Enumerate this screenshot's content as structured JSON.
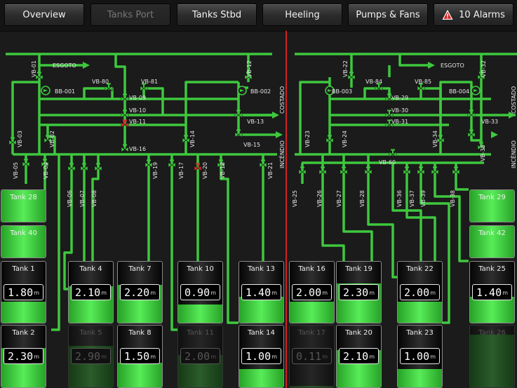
{
  "nav": {
    "overview": "Overview",
    "tanks_port": "Tanks Port",
    "tanks_stbd": "Tanks Stbd",
    "heeling": "Heeling",
    "pumps_fans": "Pumps & Fans",
    "alarms": "10 Alarms"
  },
  "colors": {
    "pipe": "#3ec83e",
    "valve_alarm": "#e0282e",
    "divider": "#d42020"
  },
  "valves": {
    "vb01": "VB-01",
    "vb02": "VB-02",
    "vb03": "VB-03",
    "vb04": "VB-04",
    "vb05": "VB-05",
    "vb06": "VB-06",
    "vb07": "VB-07",
    "vb08": "VB-08",
    "vb09": "VB-09",
    "vb10": "VB-10",
    "vb11": "VB-11",
    "vb12": "VB-12",
    "vb13": "VB-13",
    "vb14": "VB-14",
    "vb15": "VB-15",
    "vb16": "VB-16",
    "vb17": "VB-17",
    "vb18": "VB-18",
    "vb19": "VB-19",
    "vb20": "VB-20",
    "vb21": "VB-21",
    "vb22": "VB-22",
    "vb23": "VB-23",
    "vb24": "VB-24",
    "vb25": "VB-25",
    "vb26": "VB-26",
    "vb27": "VB-27",
    "vb28": "VB-28",
    "vb29": "VB-29",
    "vb30": "VB-30",
    "vb31": "VB-31",
    "vb32": "VB-32",
    "vb33": "VB-33",
    "vb34": "VB-34",
    "vb35": "VB-35",
    "vb36": "VB-36",
    "vb37": "VB-37",
    "vb38": "VB-38",
    "vb39": "VB-39",
    "vb60": "VB-60",
    "vb80": "VB-80",
    "vb81": "VB-81",
    "vb84": "VB-84",
    "vb85": "VB-85"
  },
  "pumps": {
    "bb001": "BB-001",
    "bb002": "BB-002",
    "bb003": "BB-003",
    "bb004": "BB-004"
  },
  "labels": {
    "esgoto": "ESGOTO",
    "costado": "COSTADO",
    "incendio": "INCÊNDIO"
  },
  "unit": "m",
  "tanks": {
    "t28": {
      "name": "Tank 28"
    },
    "t40": {
      "name": "Tank 40"
    },
    "t29": {
      "name": "Tank 29"
    },
    "t42": {
      "name": "Tank 42"
    },
    "t1": {
      "name": "Tank 1",
      "value": "1.80",
      "level": 0.34
    },
    "t4": {
      "name": "Tank 4",
      "value": "2.10",
      "level": 0.6
    },
    "t7": {
      "name": "Tank 7",
      "value": "2.20",
      "level": 0.62
    },
    "t10": {
      "name": "Tank 10",
      "value": "0.90",
      "level": 0.3
    },
    "t13": {
      "name": "Tank 13",
      "value": "1.40",
      "level": 0.43
    },
    "t16": {
      "name": "Tank 16",
      "value": "2.00",
      "level": 0.35
    },
    "t19": {
      "name": "Tank 19",
      "value": "2.30",
      "level": 0.64
    },
    "t22": {
      "name": "Tank 22",
      "value": "2.00",
      "level": 0.35
    },
    "t25": {
      "name": "Tank 25",
      "value": "1.40",
      "level": 0.43
    },
    "t2": {
      "name": "Tank 2",
      "value": "2.30",
      "level": 0.64
    },
    "t5": {
      "name": "Tank 5",
      "value": "2.90",
      "level": 0.67
    },
    "t8": {
      "name": "Tank 8",
      "value": "1.50",
      "level": 0.4
    },
    "t11": {
      "name": "Tank 11",
      "value": "2.00",
      "level": 0.52
    },
    "t14": {
      "name": "Tank 14",
      "value": "1.00",
      "level": 0.3
    },
    "t17": {
      "name": "Tank 17",
      "value": "0.11",
      "level": 0.02
    },
    "t20": {
      "name": "Tank 20",
      "value": "2.10",
      "level": 0.6
    },
    "t23": {
      "name": "Tank 23",
      "value": "1.00",
      "level": 0.3
    },
    "t26": {
      "name": "Tank 26",
      "level": 0.85
    }
  }
}
